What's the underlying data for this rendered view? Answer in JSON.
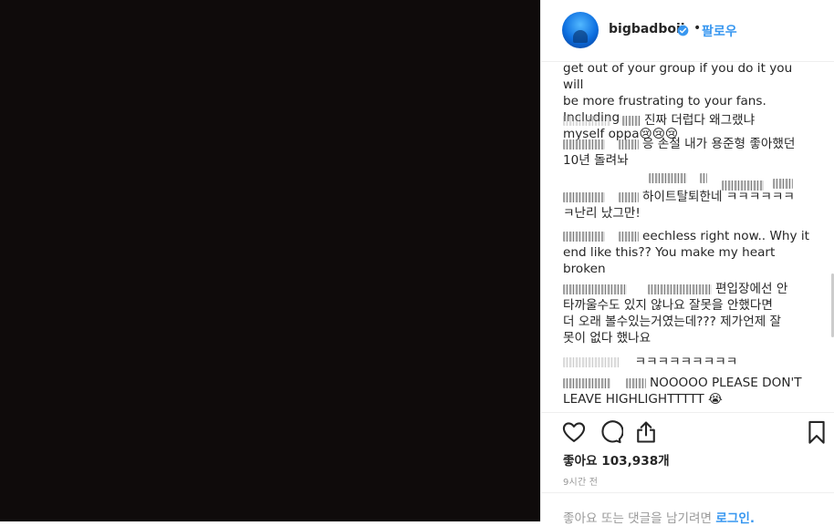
{
  "post": {
    "username": "bigbadboii",
    "follow_label": "팔로우",
    "dot": "•"
  },
  "comments": [
    {
      "text_lines": [
        "get out of your group if you do it you will",
        "be more frustrating to your fans. Including",
        "myself oppa😢😢😢"
      ]
    },
    {
      "text": "진짜 더럽다 왜그랬냐"
    },
    {
      "text_lines": [
        "응 손절 내가 용준형 좋아했던",
        "10년 돌려놔"
      ]
    },
    {
      "text_lines": [
        "하이트탈퇴한네 ㅋㅋㅋㅋㅋㅋ",
        "ㅋ난리 났그만!"
      ]
    },
    {
      "text_lines": [
        "eechless right now.. Why it",
        "end like this?? You make my heart broken"
      ]
    },
    {
      "text_lines": [
        "편입장에선 안",
        "타까울수도 있지 않나요 잘못을 안했다면",
        "더 오래 볼수있는거였는데??? 제가언제 잘",
        "못이 없다 했나요"
      ]
    },
    {
      "text": "ㅋㅋㅋㅋㅋㅋㅋㅋㅋ"
    },
    {
      "text_lines": [
        "NOOOOO PLEASE DON'T",
        "LEAVE HIGHLIGHTTTTT 😭"
      ]
    }
  ],
  "likes": "좋아요 103,938개",
  "time_ago": "9시간 전",
  "login": {
    "prefix": "좋아요 또는 댓글을 남기려면",
    "link": "로그인."
  },
  "icons": {
    "like": "heart-icon",
    "comment": "comment-icon",
    "share": "share-icon",
    "save": "bookmark-icon",
    "verified": "verified-badge-icon"
  },
  "colors": {
    "media_bg": "#0f0b0b",
    "link_blue": "#3897f0",
    "text": "#262626",
    "muted": "#999999"
  }
}
